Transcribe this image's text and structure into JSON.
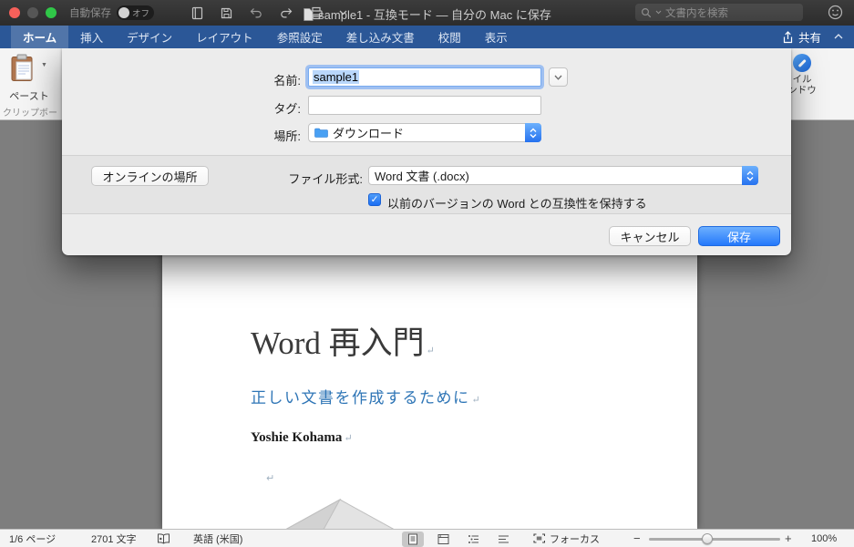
{
  "titlebar": {
    "autosave_label": "自動保存",
    "autosave_state": "オフ",
    "doc_title": "sample1 - 互換モード — 自分の Mac に保存",
    "search_placeholder": "文書内を検索"
  },
  "tabbar": {
    "tabs": [
      "ホーム",
      "挿入",
      "デザイン",
      "レイアウト",
      "参照設定",
      "差し込み文書",
      "校閲",
      "表示"
    ],
    "active_tab": "ホーム",
    "share_label": "共有"
  },
  "ribbon": {
    "paste_label": "ペースト",
    "clipboard_group_label": "クリップボー",
    "styles_label_fragment_top": "イル",
    "styles_label_fragment_bottom": "ンドウ"
  },
  "save_dialog": {
    "name_label": "名前:",
    "name_value": "sample1",
    "tags_label": "タグ:",
    "tags_value": "",
    "where_label": "場所:",
    "where_value": "ダウンロード",
    "online_locations_button": "オンラインの場所",
    "file_format_label": "ファイル形式:",
    "file_format_value": "Word 文書 (.docx)",
    "compatibility_label": "以前のバージョンの Word との互換性を保持する",
    "compatibility_checked": true,
    "cancel_button": "キャンセル",
    "save_button": "保存"
  },
  "document": {
    "title": "Word 再入門",
    "subtitle": "正しい文書を作成するために",
    "author": "Yoshie Kohama",
    "paragraph_mark": "↵"
  },
  "statusbar": {
    "page_indicator": "1/6 ページ",
    "word_count": "2701 文字",
    "language": "英語 (米国)",
    "focus_label": "フォーカス",
    "zoom_level": "100%"
  },
  "glyphs": {
    "caret_down": "▼",
    "check": "✓",
    "minus": "−",
    "plus": "+"
  },
  "colors": {
    "ribbon_blue": "#2b5797",
    "primary_button_blue": "#2f7df7",
    "subtitle_blue": "#2e75b6",
    "selection_blue": "#b9d7fb"
  }
}
